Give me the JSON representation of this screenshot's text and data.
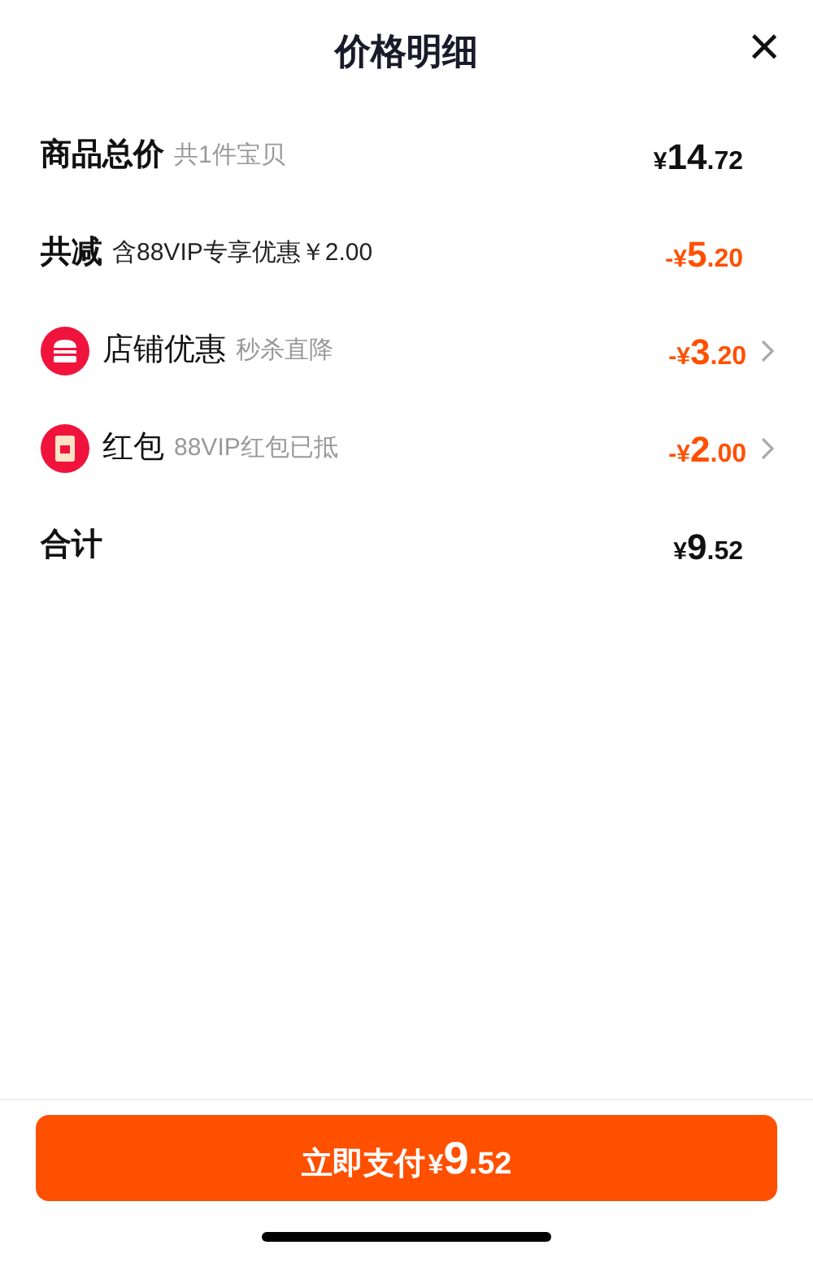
{
  "header": {
    "title": "价格明细",
    "close": "×"
  },
  "rows": [
    {
      "kind": "total",
      "label": "商品总价",
      "note": "共1件宝贝",
      "price": {
        "sign": "¥",
        "integer": "14",
        "decimal": ".72"
      }
    },
    {
      "kind": "discount",
      "label": "共减",
      "note": "含88VIP专享优惠￥2.00",
      "price": {
        "sign": "-¥",
        "integer": "5",
        "decimal": ".20"
      }
    },
    {
      "kind": "shop",
      "label": "店铺优惠",
      "note": "秒杀直降",
      "price": {
        "sign": "-¥",
        "integer": "3",
        "decimal": ".20"
      }
    },
    {
      "kind": "packet",
      "label": "红包",
      "note": "88VIP红包已抵",
      "price": {
        "sign": "-¥",
        "integer": "2",
        "decimal": ".00"
      }
    },
    {
      "kind": "total",
      "label": "合计",
      "price": {
        "sign": "¥",
        "integer": "9",
        "decimal": ".52"
      }
    }
  ],
  "pay_button": {
    "label": "立即支付",
    "price": {
      "sign": "¥",
      "integer": "9",
      "decimal": ".52"
    }
  }
}
